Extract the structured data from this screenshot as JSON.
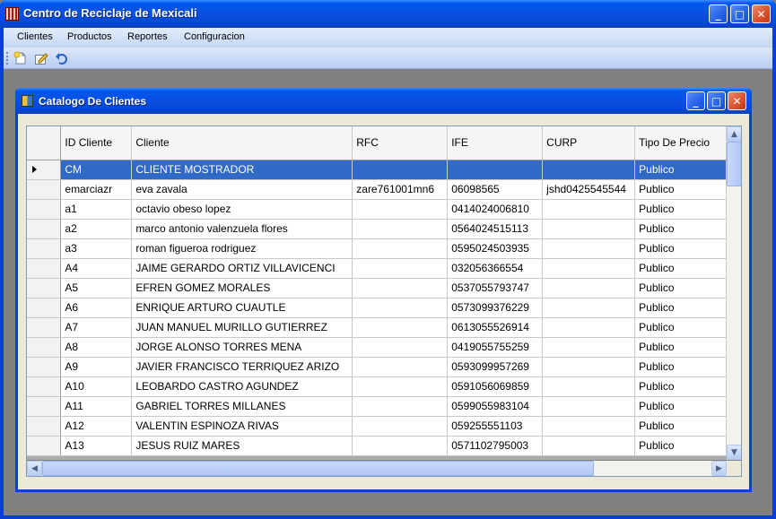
{
  "window": {
    "title": "Centro de Reciclaje de Mexicali",
    "buttons": {
      "minimize": "_",
      "maximize": "□",
      "close": "✕"
    }
  },
  "menu": [
    "Clientes",
    "Productos",
    "Reportes",
    "Configuracion"
  ],
  "toolbar": [
    {
      "icon": "new-document-icon"
    },
    {
      "icon": "edit-icon"
    },
    {
      "icon": "undo-icon"
    }
  ],
  "child_window": {
    "title": "Catalogo De Clientes"
  },
  "grid": {
    "columns": [
      {
        "key": "id",
        "label": "ID Cliente"
      },
      {
        "key": "cliente",
        "label": "Cliente"
      },
      {
        "key": "rfc",
        "label": "RFC"
      },
      {
        "key": "ife",
        "label": "IFE"
      },
      {
        "key": "curp",
        "label": "CURP"
      },
      {
        "key": "tipo",
        "label": "Tipo De Precio"
      }
    ],
    "selected_row": 0,
    "rows": [
      [
        "CM",
        "CLIENTE MOSTRADOR",
        "",
        "",
        "",
        "Publico"
      ],
      [
        "emarciazr",
        "eva zavala",
        "zare761001mn6",
        "06098565",
        "jshd0425545544",
        "Publico"
      ],
      [
        "a1",
        "octavio obeso lopez",
        "",
        "0414024006810",
        "",
        "Publico"
      ],
      [
        "a2",
        "marco antonio valenzuela flores",
        "",
        "0564024515113",
        "",
        "Publico"
      ],
      [
        "a3",
        "roman figueroa rodriguez",
        "",
        "0595024503935",
        "",
        "Publico"
      ],
      [
        "A4",
        "JAIME GERARDO ORTIZ VILLAVICENCI",
        "",
        "032056366554",
        "",
        "Publico"
      ],
      [
        "A5",
        "EFREN GOMEZ MORALES",
        "",
        "0537055793747",
        "",
        "Publico"
      ],
      [
        "A6",
        "ENRIQUE ARTURO CUAUTLE",
        "",
        "0573099376229",
        "",
        "Publico"
      ],
      [
        "A7",
        "JUAN MANUEL MURILLO GUTIERREZ",
        "",
        "0613055526914",
        "",
        "Publico"
      ],
      [
        "A8",
        "JORGE ALONSO TORRES MENA",
        "",
        "0419055755259",
        "",
        "Publico"
      ],
      [
        "A9",
        "JAVIER FRANCISCO TERRIQUEZ ARIZO",
        "",
        "0593099957269",
        "",
        "Publico"
      ],
      [
        "A10",
        "LEOBARDO CASTRO AGUNDEZ",
        "",
        "0591056069859",
        "",
        "Publico"
      ],
      [
        "A11",
        "GABRIEL TORRES MILLANES",
        "",
        "0599055983104",
        "",
        "Publico"
      ],
      [
        "A12",
        "VALENTIN ESPINOZA RIVAS",
        "",
        "059255551103",
        "",
        "Publico"
      ],
      [
        "A13",
        "JESUS RUIZ MARES",
        "",
        "0571102795003",
        "",
        "Publico"
      ]
    ]
  }
}
